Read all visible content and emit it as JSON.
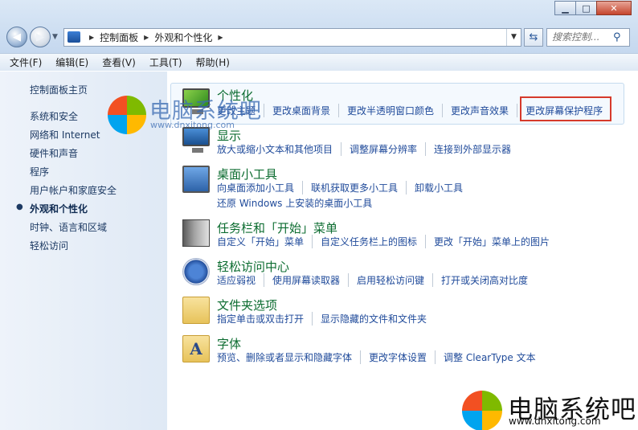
{
  "window": {
    "buttons": {
      "minimize": "▁",
      "maximize": "□",
      "close": "✕"
    }
  },
  "address": {
    "path": [
      "控制面板",
      "外观和个性化"
    ],
    "search_placeholder": "搜索控制..."
  },
  "menu": [
    "文件(F)",
    "编辑(E)",
    "查看(V)",
    "工具(T)",
    "帮助(H)"
  ],
  "sidebar": {
    "home": "控制面板主页",
    "items": [
      "系统和安全",
      "网络和 Internet",
      "硬件和声音",
      "程序",
      "用户帐户和家庭安全",
      "外观和个性化",
      "时钟、语言和区域",
      "轻松访问"
    ],
    "active_index": 5
  },
  "categories": [
    {
      "icon": "personalization-icon",
      "title": "个性化",
      "rows": [
        [
          "更改主题",
          "更改桌面背景",
          "更改半透明窗口颜色",
          "更改声音效果",
          "更改屏幕保护程序"
        ]
      ]
    },
    {
      "icon": "display-icon",
      "title": "显示",
      "rows": [
        [
          "放大或缩小文本和其他项目",
          "调整屏幕分辨率",
          "连接到外部显示器"
        ]
      ]
    },
    {
      "icon": "desktop-gadgets-icon",
      "title": "桌面小工具",
      "rows": [
        [
          "向桌面添加小工具",
          "联机获取更多小工具",
          "卸载小工具"
        ],
        [
          "还原 Windows 上安装的桌面小工具"
        ]
      ]
    },
    {
      "icon": "taskbar-icon",
      "title": "任务栏和「开始」菜单",
      "rows": [
        [
          "自定义「开始」菜单",
          "自定义任务栏上的图标",
          "更改「开始」菜单上的图片"
        ]
      ]
    },
    {
      "icon": "ease-of-access-icon",
      "title": "轻松访问中心",
      "rows": [
        [
          "适应弱视",
          "使用屏幕读取器",
          "启用轻松访问键",
          "打开或关闭高对比度"
        ]
      ]
    },
    {
      "icon": "folder-options-icon",
      "title": "文件夹选项",
      "rows": [
        [
          "指定单击或双击打开",
          "显示隐藏的文件和文件夹"
        ]
      ]
    },
    {
      "icon": "fonts-icon",
      "title": "字体",
      "rows": [
        [
          "预览、删除或者显示和隐藏字体",
          "更改字体设置",
          "调整 ClearType 文本"
        ]
      ]
    }
  ],
  "watermark": {
    "name": "电脑系统吧",
    "url": "www.dnxitong.com"
  },
  "colors": {
    "category_title": "#0c6c30",
    "link": "#1f4a9a",
    "annotation_box": "#d63a2b"
  }
}
